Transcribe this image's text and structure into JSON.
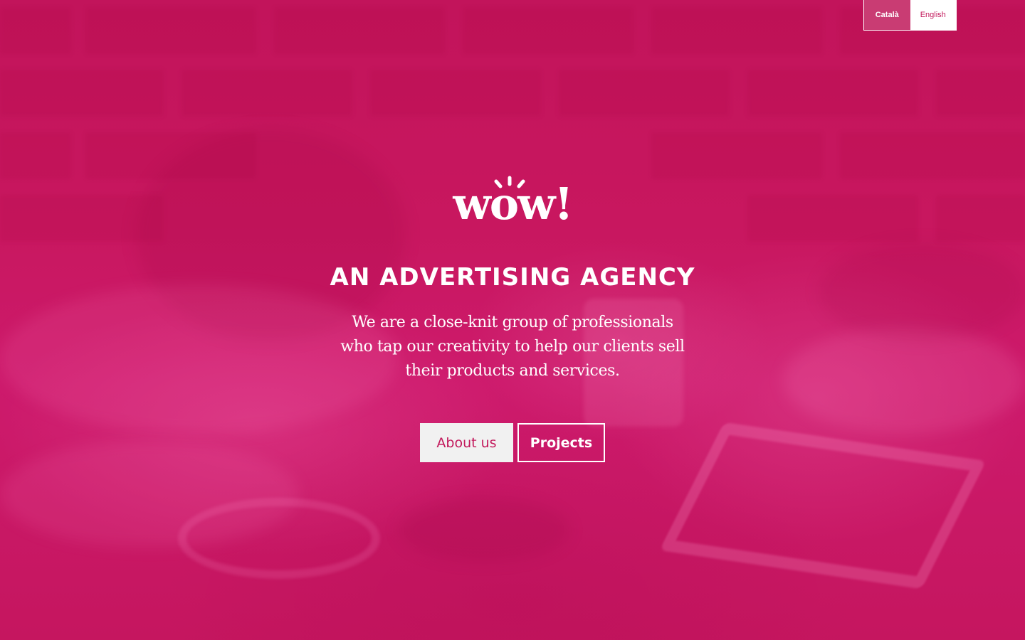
{
  "language_switcher": {
    "active_label": "Català",
    "inactive_label": "English"
  },
  "logo": {
    "text": "wow!"
  },
  "hero": {
    "headline": "AN ADVERTISING AGENCY",
    "lead": "We are a close-knit group of professionals who tap our creativity to help our clients sell their products and services."
  },
  "buttons": {
    "about_label": "About us",
    "projects_label": "Projects"
  },
  "colors": {
    "brand_magenta": "#c8175f",
    "active_language_bg": "#c93c73",
    "button_light_bg": "#f1f1f1",
    "text_white": "#ffffff"
  }
}
